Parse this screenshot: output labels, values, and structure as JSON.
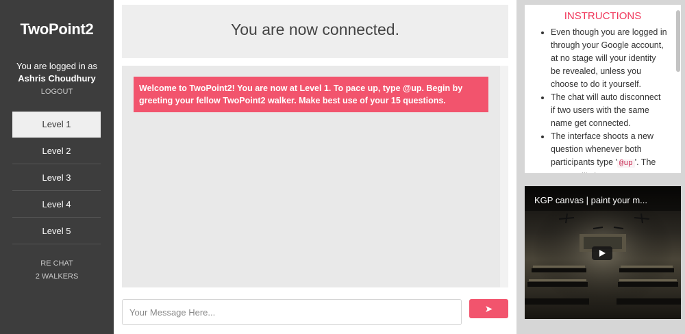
{
  "sidebar": {
    "brand": "TwoPoint2",
    "logged_in_label": "You are logged in as",
    "user_name": "Ashris Choudhury",
    "logout": "LOGOUT",
    "levels": [
      {
        "label": "Level 1",
        "active": true
      },
      {
        "label": "Level 2",
        "active": false
      },
      {
        "label": "Level 3",
        "active": false
      },
      {
        "label": "Level 4",
        "active": false
      },
      {
        "label": "Level 5",
        "active": false
      }
    ],
    "rechat": "RE CHAT",
    "walkers": "2 WALKERS"
  },
  "main": {
    "status": "You are now connected.",
    "welcome_message": "Welcome to TwoPoint2! You are now at Level 1. To pace up, type @up. Begin by greeting your fellow TwoPoint2 walker. Make best use of your 15 questions.",
    "input_placeholder": "Your Message Here...",
    "send_icon": "➤"
  },
  "instructions": {
    "title": "INSTRUCTIONS",
    "items": [
      "Even though you are logged in through your Google account, at no stage will your identity be revealed, unless you choose to do it yourself.",
      "The chat will auto disconnect if two users with the same name get connected."
    ],
    "item3_before": "The interface shoots a new question whenever both participants type '",
    "item3_code": "@up",
    "item3_after": "'. The Stage will change to"
  },
  "video": {
    "title": "KGP canvas | paint your m..."
  },
  "colors": {
    "accent": "#f2546d",
    "sidebar_bg": "#3d3d3d",
    "instructions_title": "#f0365a"
  }
}
